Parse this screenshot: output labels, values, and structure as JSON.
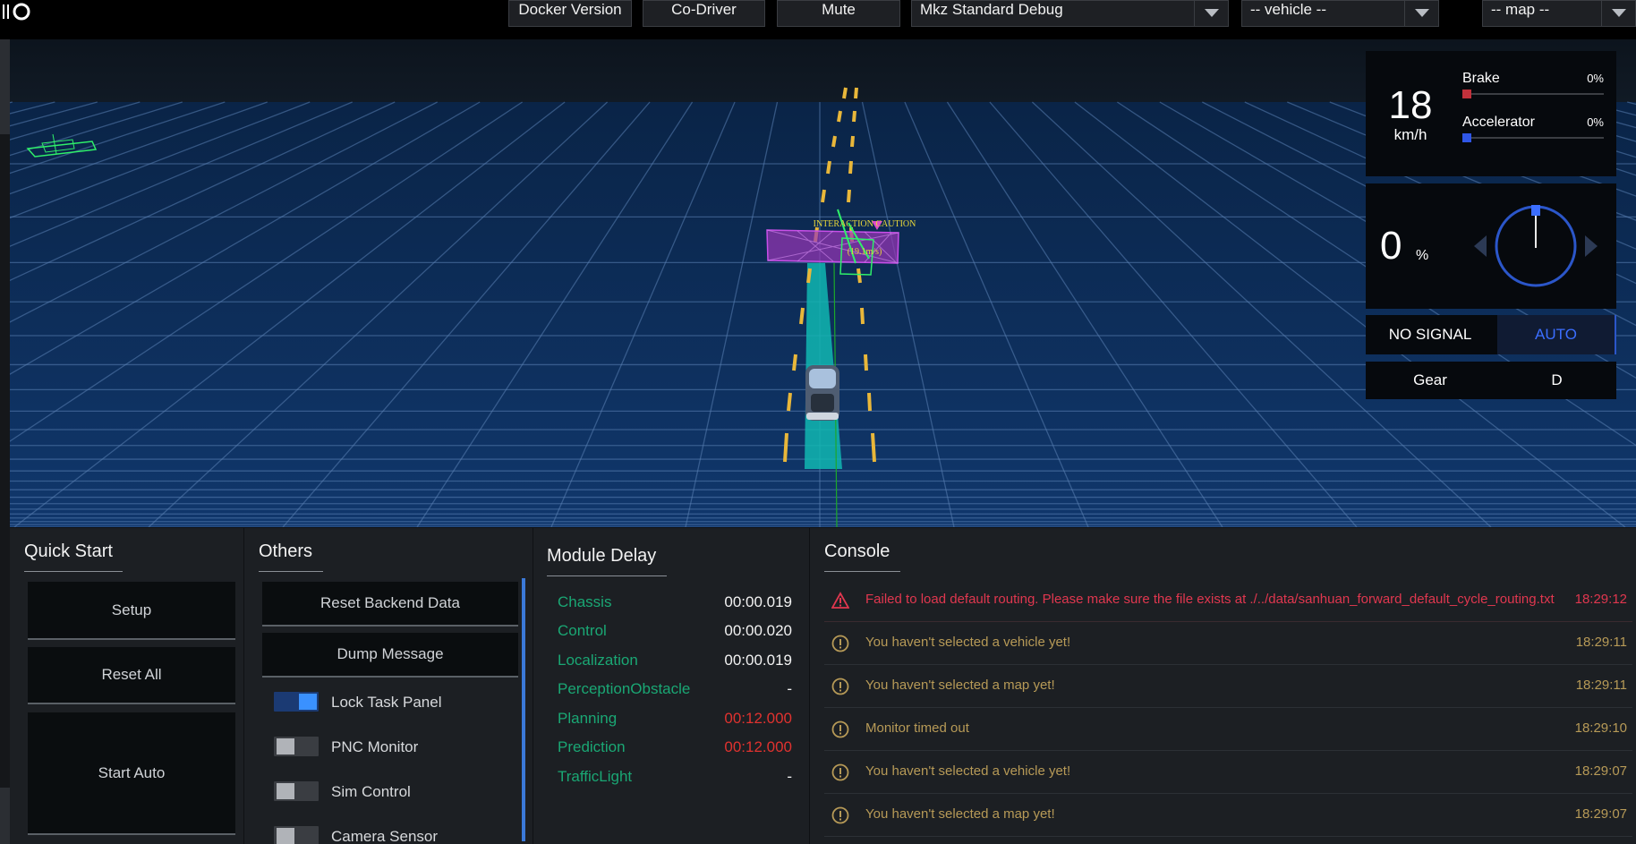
{
  "header": {
    "buttons": {
      "docker": "Docker Version",
      "codriver": "Co-Driver",
      "mute": "Mute"
    },
    "selects": {
      "mode": "Mkz Standard Debug",
      "vehicle": "-- vehicle --",
      "map": "-- map --"
    }
  },
  "scene": {
    "obstacle_label": "INTERACTION CAUTION",
    "obstacle_speed": "(19.1m/s)",
    "colors": {
      "ground": "#0e3160",
      "grid": "#4a6fa0",
      "lane_marks": "#e9b73a",
      "planning_path": "#11b7b2",
      "obstacle": "#9a36b8",
      "obstacle_outline": "#2ff06a"
    }
  },
  "dashboard": {
    "speed": "18",
    "speed_unit": "km/h",
    "brake_label": "Brake",
    "brake_pct": "0%",
    "accel_label": "Accelerator",
    "accel_pct": "0%",
    "steering": "0",
    "steering_unit": "%",
    "signal": "NO SIGNAL",
    "drive_mode": "AUTO",
    "gear_label": "Gear",
    "gear": "D",
    "colors": {
      "brake": "#c2313b",
      "accel": "#2f56e6",
      "wheel": "#2b56c9"
    }
  },
  "quick_start": {
    "title": "Quick Start",
    "setup": "Setup",
    "reset_all": "Reset All",
    "start_auto": "Start Auto"
  },
  "others": {
    "title": "Others",
    "reset_backend": "Reset Backend Data",
    "dump_message": "Dump Message",
    "toggles": [
      {
        "label": "Lock Task Panel",
        "on": true
      },
      {
        "label": "PNC Monitor",
        "on": false
      },
      {
        "label": "Sim Control",
        "on": false
      },
      {
        "label": "Camera Sensor",
        "on": false
      }
    ]
  },
  "module_delay": {
    "title": "Module Delay",
    "rows": [
      {
        "name": "Chassis",
        "value": "00:00.019"
      },
      {
        "name": "Control",
        "value": "00:00.020"
      },
      {
        "name": "Localization",
        "value": "00:00.019"
      },
      {
        "name": "PerceptionObstacle",
        "value": "-"
      },
      {
        "name": "Planning",
        "value": "00:12.000"
      },
      {
        "name": "Prediction",
        "value": "00:12.000"
      },
      {
        "name": "TrafficLight",
        "value": "-"
      }
    ]
  },
  "console": {
    "title": "Console",
    "messages": [
      {
        "level": "error",
        "text": "Failed to load default routing. Please make sure the file exists at ./../data/sanhuan_forward_default_cycle_routing.txt",
        "time": "18:29:12"
      },
      {
        "level": "warning",
        "text": "You haven't selected a vehicle yet!",
        "time": "18:29:11"
      },
      {
        "level": "warning",
        "text": "You haven't selected a map yet!",
        "time": "18:29:11"
      },
      {
        "level": "warning",
        "text": "Monitor timed out",
        "time": "18:29:10"
      },
      {
        "level": "warning",
        "text": "You haven't selected a vehicle yet!",
        "time": "18:29:07"
      },
      {
        "level": "warning",
        "text": "You haven't selected a map yet!",
        "time": "18:29:07"
      }
    ]
  }
}
